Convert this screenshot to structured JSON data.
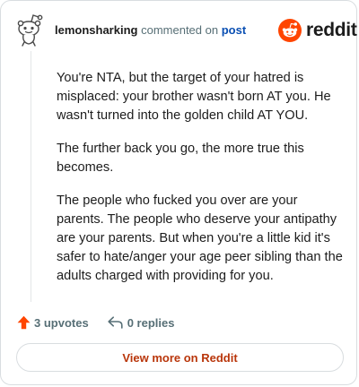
{
  "comment": {
    "username": "lemonsharking",
    "action_text": "commented on",
    "post_link": "post",
    "paragraphs": [
      "You're NTA, but the target of your hatred is misplaced: your brother wasn't born AT you. He wasn't turned into the golden child AT YOU.",
      "The further back you go, the more true this becomes.",
      "The people who fucked you over are your parents. The people who deserve your antipathy are your parents. But when you're a little kid it's safer to hate/anger your age peer sibling than the adults charged with providing for you."
    ]
  },
  "brand": {
    "name": "reddit",
    "color": "#ff4500"
  },
  "actions": {
    "upvotes": "3 upvotes",
    "replies": "0 replies",
    "upvote_icon": "upvote-arrow-icon",
    "reply_icon": "reply-arrow-icon",
    "upvote_color": "#ff4500"
  },
  "footer": {
    "view_more": "View more on Reddit"
  },
  "colors": {
    "link": "#0a4fb3",
    "button_text": "#b9360b"
  }
}
